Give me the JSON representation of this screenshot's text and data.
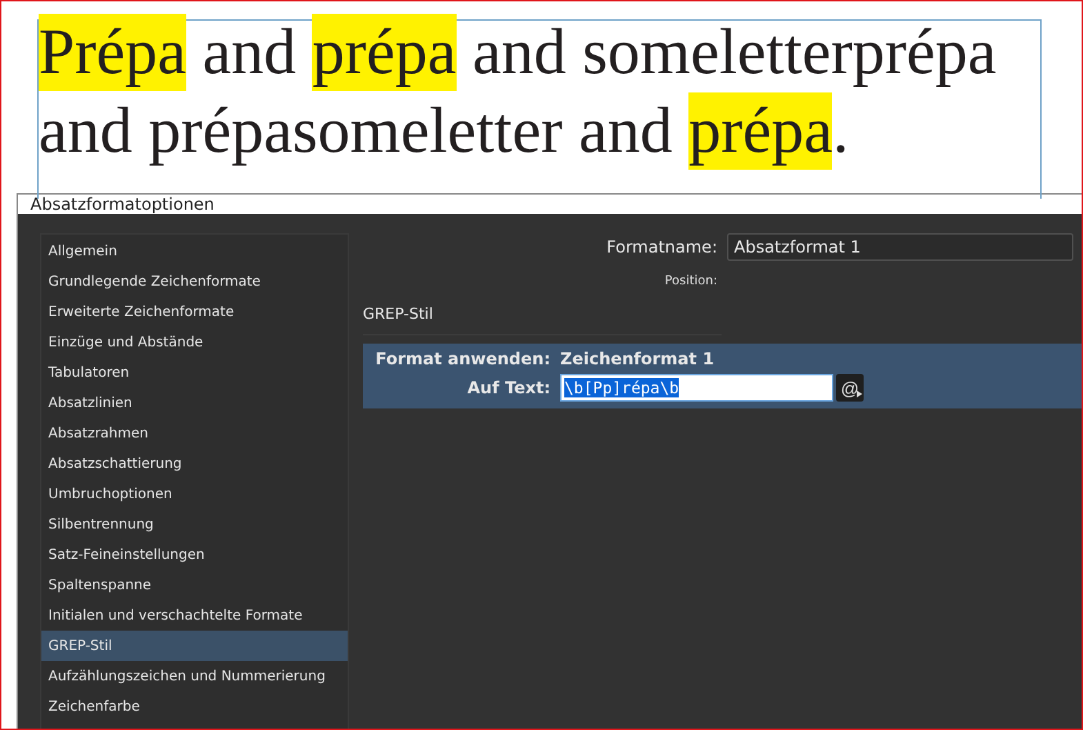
{
  "document": {
    "lines": [
      [
        {
          "text": "Prépa",
          "highlighted": true
        },
        {
          "text": " and ",
          "highlighted": false
        },
        {
          "text": "prépa",
          "highlighted": true
        },
        {
          "text": " and someletterprépa",
          "highlighted": false
        }
      ],
      [
        {
          "text": "and prépasomeletter and ",
          "highlighted": false
        },
        {
          "text": "prépa",
          "highlighted": true
        },
        {
          "text": ".",
          "highlighted": false
        }
      ]
    ]
  },
  "dialog": {
    "title": "Absatzformatoptionen",
    "sidebar": {
      "items": [
        {
          "label": "Allgemein",
          "selected": false
        },
        {
          "label": "Grundlegende Zeichenformate",
          "selected": false
        },
        {
          "label": "Erweiterte Zeichenformate",
          "selected": false
        },
        {
          "label": "Einzüge und Abstände",
          "selected": false
        },
        {
          "label": "Tabulatoren",
          "selected": false
        },
        {
          "label": "Absatzlinien",
          "selected": false
        },
        {
          "label": "Absatzrahmen",
          "selected": false
        },
        {
          "label": "Absatzschattierung",
          "selected": false
        },
        {
          "label": "Umbruchoptionen",
          "selected": false
        },
        {
          "label": "Silbentrennung",
          "selected": false
        },
        {
          "label": "Satz-Feineinstellungen",
          "selected": false
        },
        {
          "label": "Spaltenspanne",
          "selected": false
        },
        {
          "label": "Initialen und verschachtelte Formate",
          "selected": false
        },
        {
          "label": "GREP-Stil",
          "selected": true
        },
        {
          "label": "Aufzählungszeichen und Nummerierung",
          "selected": false
        },
        {
          "label": "Zeichenfarbe",
          "selected": false
        }
      ]
    },
    "format_name": {
      "label": "Formatname:",
      "value": "Absatzformat 1"
    },
    "position": {
      "label": "Position:"
    },
    "section_title": "GREP-Stil",
    "grep_rule": {
      "selected": true,
      "apply_label": "Format anwenden:",
      "apply_value": "Zeichenformat 1",
      "text_label": "Auf Text:",
      "text_value": "\\b[Pp]répa\\b",
      "text_selected": true,
      "special_button": "@"
    }
  }
}
